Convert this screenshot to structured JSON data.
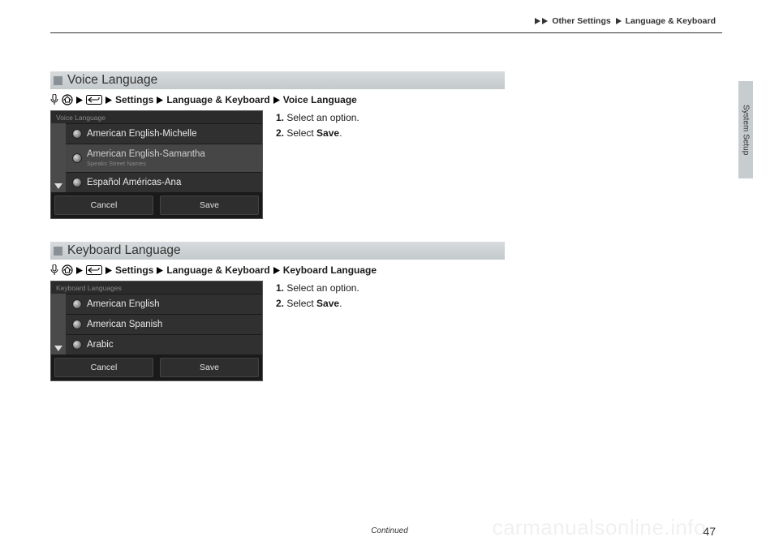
{
  "breadcrumb": {
    "part1": "Other Settings",
    "part2": "Language & Keyboard"
  },
  "side_tab": "System Setup",
  "sections": [
    {
      "heading": "Voice Language",
      "nav": {
        "settings": "Settings",
        "group": "Language & Keyboard",
        "leaf": "Voice Language"
      },
      "screenshot": {
        "title": "Voice Language",
        "items": [
          {
            "label": "American English-Michelle",
            "sub": ""
          },
          {
            "label": "American English-Samantha",
            "sub": "Speaks Street Names",
            "dim": true
          },
          {
            "label": "Español Américas-Ana",
            "sub": ""
          }
        ],
        "cancel": "Cancel",
        "save": "Save"
      },
      "steps": {
        "s1_n": "1.",
        "s1_t": "Select an option.",
        "s2_n": "2.",
        "s2_t_a": "Select ",
        "s2_t_b": "Save",
        "s2_t_c": "."
      }
    },
    {
      "heading": "Keyboard Language",
      "nav": {
        "settings": "Settings",
        "group": "Language & Keyboard",
        "leaf": "Keyboard Language"
      },
      "screenshot": {
        "title": "Keyboard Languages",
        "items": [
          {
            "label": "American English",
            "sub": ""
          },
          {
            "label": "American Spanish",
            "sub": ""
          },
          {
            "label": "Arabic",
            "sub": ""
          }
        ],
        "cancel": "Cancel",
        "save": "Save"
      },
      "steps": {
        "s1_n": "1.",
        "s1_t": "Select an option.",
        "s2_n": "2.",
        "s2_t_a": "Select ",
        "s2_t_b": "Save",
        "s2_t_c": "."
      }
    }
  ],
  "footer_continued": "Continued",
  "page_number": "47",
  "watermark": "carmanualsonline.info"
}
